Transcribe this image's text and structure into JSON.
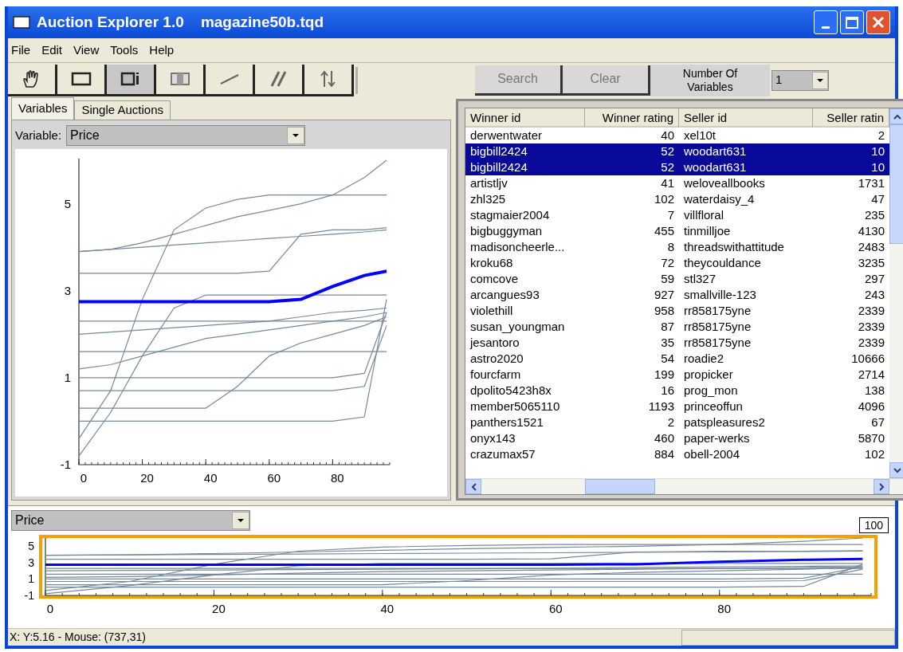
{
  "window": {
    "title": "Auction Explorer 1.0    magazine50b.tqd"
  },
  "menu": [
    "File",
    "Edit",
    "View",
    "Tools",
    "Help"
  ],
  "toolbar": {
    "tools": [
      {
        "kind": "hand",
        "selected": false
      },
      {
        "kind": "rectangle",
        "selected": false
      },
      {
        "kind": "rectangle-info",
        "selected": true
      },
      {
        "kind": "columns",
        "selected": false
      },
      {
        "kind": "slope",
        "selected": false
      },
      {
        "kind": "parallel",
        "selected": false
      },
      {
        "kind": "updown",
        "selected": false
      }
    ],
    "search_buttons": [
      {
        "label": "Search",
        "disabled": true
      },
      {
        "label": "Clear",
        "disabled": true
      }
    ],
    "variables_label": "Number Of Variables",
    "variables_value": "1"
  },
  "tabs": [
    {
      "label": "Variables",
      "selected": true
    },
    {
      "label": "Single Auctions",
      "selected": false
    }
  ],
  "variable_select": {
    "label": "Variable:",
    "value": "Price"
  },
  "main_chart": {
    "y_tick_labels": [
      "5",
      "3",
      "1",
      "-1"
    ],
    "x_tick_labels": [
      "0",
      "20",
      "40",
      "60",
      "80"
    ]
  },
  "table": {
    "columns": [
      "Winner id",
      "Winner rating",
      "Seller id",
      "Seller ratin"
    ],
    "rows": [
      {
        "cells": [
          "derwentwater",
          "40",
          "xel10t",
          "2"
        ],
        "selected": false
      },
      {
        "cells": [
          "bigbill2424",
          "52",
          "woodart631",
          "10"
        ],
        "selected": true
      },
      {
        "cells": [
          "bigbill2424",
          "52",
          "woodart631",
          "10"
        ],
        "selected": true
      },
      {
        "cells": [
          "artistljv",
          "41",
          "weloveallbooks",
          "1731"
        ],
        "selected": false
      },
      {
        "cells": [
          "zhl325",
          "102",
          "waterdaisy_4",
          "47"
        ],
        "selected": false
      },
      {
        "cells": [
          "stagmaier2004",
          "7",
          "villfloral",
          "235"
        ],
        "selected": false
      },
      {
        "cells": [
          "bigbuggyman",
          "455",
          "tinmilljoe",
          "4130"
        ],
        "selected": false
      },
      {
        "cells": [
          "madisoncheerle...",
          "8",
          "threadswithattitude",
          "2483"
        ],
        "selected": false
      },
      {
        "cells": [
          "kroku68",
          "72",
          "theycouldance",
          "3235"
        ],
        "selected": false
      },
      {
        "cells": [
          "comcove",
          "59",
          "stl327",
          "297"
        ],
        "selected": false
      },
      {
        "cells": [
          "arcangues93",
          "927",
          "smallville-123",
          "243"
        ],
        "selected": false
      },
      {
        "cells": [
          "violethill",
          "958",
          "rr858175yne",
          "2339"
        ],
        "selected": false
      },
      {
        "cells": [
          "susan_youngman",
          "87",
          "rr858175yne",
          "2339"
        ],
        "selected": false
      },
      {
        "cells": [
          "jesantoro",
          "35",
          "rr858175yne",
          "2339"
        ],
        "selected": false
      },
      {
        "cells": [
          "astro2020",
          "54",
          "roadie2",
          "10666"
        ],
        "selected": false
      },
      {
        "cells": [
          "fourcfarm",
          "199",
          "propicker",
          "2714"
        ],
        "selected": false
      },
      {
        "cells": [
          "dpolito5423h8x",
          "16",
          "prog_mon",
          "138"
        ],
        "selected": false
      },
      {
        "cells": [
          "member5065110",
          "1193",
          "princeoffun",
          "4096"
        ],
        "selected": false
      },
      {
        "cells": [
          "panthers1521",
          "2",
          "patspleasures2",
          "67"
        ],
        "selected": false
      },
      {
        "cells": [
          "onyx143",
          "460",
          "paper-werks",
          "5870"
        ],
        "selected": false
      },
      {
        "cells": [
          "crazumax57",
          "884",
          "obell-2004",
          "102"
        ],
        "selected": false
      }
    ]
  },
  "overview": {
    "select_value": "Price",
    "window_label": "100",
    "y_tick_labels": [
      "5",
      "3",
      "1",
      "-1"
    ],
    "x_tick_labels": [
      "0",
      "20",
      "40",
      "60",
      "80"
    ]
  },
  "status_bar": {
    "text": "X: Y:5.16 - Mouse: (737,31)"
  }
}
